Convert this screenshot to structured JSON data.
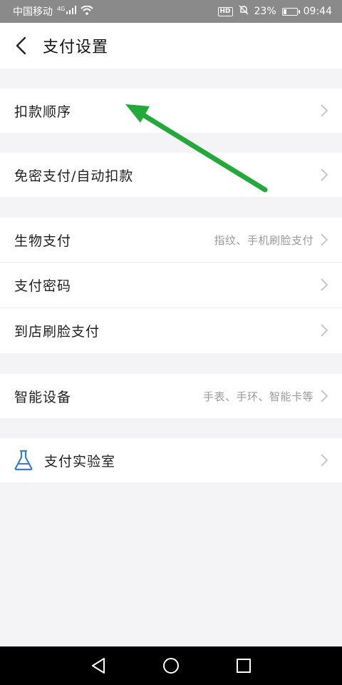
{
  "status_bar": {
    "carrier": "中国移动",
    "network": "4G",
    "battery_percent": "23%",
    "battery_level": 0.23,
    "time": "09:44",
    "hd_label": "HD"
  },
  "header": {
    "title": "支付设置"
  },
  "groups": [
    {
      "items": [
        {
          "label": "扣款顺序",
          "hint": ""
        }
      ]
    },
    {
      "items": [
        {
          "label": "免密支付/自动扣款",
          "hint": ""
        }
      ]
    },
    {
      "items": [
        {
          "label": "生物支付",
          "hint": "指纹、手机刷脸支付"
        },
        {
          "label": "支付密码",
          "hint": ""
        },
        {
          "label": "到店刷脸支付",
          "hint": ""
        }
      ]
    },
    {
      "items": [
        {
          "label": "智能设备",
          "hint": "手表、手环、智能卡等"
        }
      ]
    },
    {
      "items": [
        {
          "label": "支付实验室",
          "hint": "",
          "icon": "flask-icon"
        }
      ]
    }
  ],
  "colors": {
    "annotation_arrow": "#22a93a",
    "lab_icon": "#3a7bd5",
    "status_bar_bg": "#8a8a8a"
  }
}
